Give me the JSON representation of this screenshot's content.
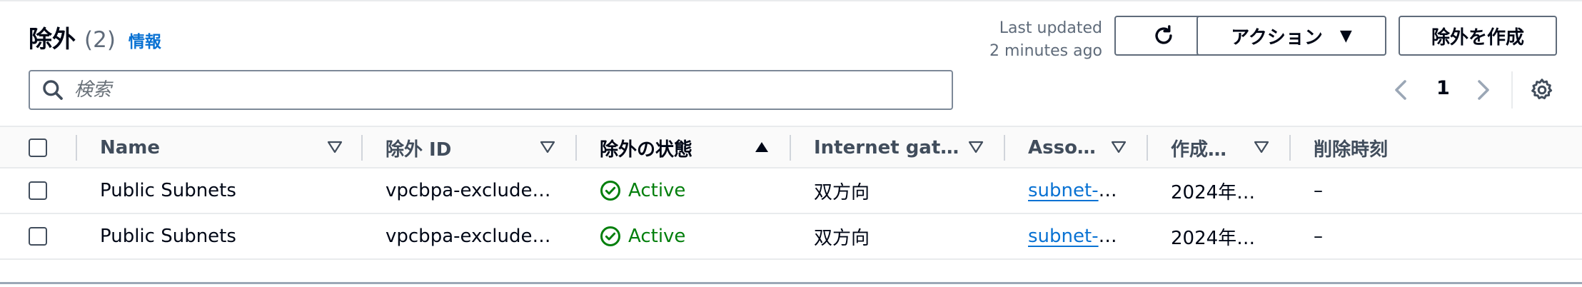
{
  "header": {
    "title": "除外",
    "count": "(2)",
    "info": "情報",
    "updated_line1": "Last updated",
    "updated_line2": "2 minutes ago",
    "actions_label": "アクション",
    "create_label": "除外を作成"
  },
  "search": {
    "placeholder": "検索"
  },
  "pagination": {
    "current_page": "1"
  },
  "table": {
    "columns": [
      "Name",
      "除外 ID",
      "除外の状態",
      "Internet gat…",
      "Asso…",
      "作成…",
      "削除時刻"
    ],
    "rows": [
      {
        "name": "Public Subnets",
        "id": "vpcbpa-exclude…",
        "status": "Active",
        "internet_gateway": "双方向",
        "assoc_link": "subnet-",
        "assoc_rest": "…",
        "created": "2024年…",
        "deleted": "–"
      },
      {
        "name": "Public Subnets",
        "id": "vpcbpa-exclude…",
        "status": "Active",
        "internet_gateway": "双方向",
        "assoc_link": "subnet-",
        "assoc_rest": "…",
        "created": "2024年…",
        "deleted": "–"
      }
    ]
  },
  "icons": {
    "refresh": "refresh-icon",
    "search": "search-icon",
    "settings": "gear-icon",
    "status": "check-circle-icon"
  },
  "colors": {
    "link": "#0972d3",
    "success": "#037f0c",
    "text": "#000716",
    "border": "#5f6b7a"
  }
}
